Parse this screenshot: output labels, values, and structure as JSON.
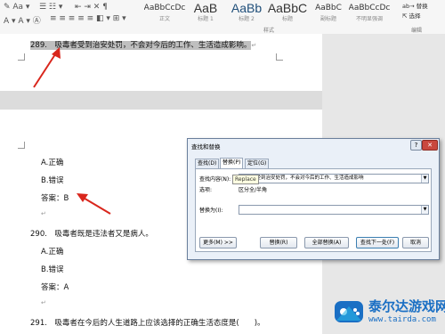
{
  "ribbon": {
    "styles": [
      {
        "preview": "AaBbCcDc",
        "label": "正文"
      },
      {
        "preview": "AaB",
        "label": "标题 1"
      },
      {
        "preview": "AaBb",
        "label": "标题 2"
      },
      {
        "preview": "AaBbC",
        "label": "标题"
      },
      {
        "preview": "AaBbC",
        "label": "副标题"
      },
      {
        "preview": "AaBbCcDc",
        "label": "不明显强调"
      }
    ],
    "styles_group_label": "样式",
    "editing": {
      "replace": "替换",
      "select": "选择",
      "group_label": "编辑"
    }
  },
  "document": {
    "q289": "289.　吸毒者受到治安处罚，不会对今后的工作、生活造成影响。",
    "opt_a": "A.正确",
    "opt_b": "B.错误",
    "ans_label": "答案：",
    "ans_value": "B",
    "q290": "290.　吸毒者既是违法者又是病人。",
    "opt_a2": "A.正确",
    "opt_b2": "B.错误",
    "ans2": "答案：A",
    "q291": "291.　吸毒者在今后的人生道路上应该选择的正确生活态度是(　　)。"
  },
  "dialog": {
    "title": "查找和替换",
    "help": "?",
    "close": "✕",
    "tabs": [
      "查找(D)",
      "替换(P)",
      "定位(G)"
    ],
    "active_tab": 1,
    "find_label": "查找内容(N):",
    "find_value": "吸毒者受到治安处罚，不会对今后的工作、生活造成影响",
    "options_label": "选项:",
    "options_value": "区分全/半角",
    "replace_label": "替换为(I):",
    "replace_value": "",
    "tooltip": "Replace",
    "buttons": {
      "more": "更多(M) >>",
      "replace": "替换(R)",
      "replace_all": "全部替换(A)",
      "find_next": "查找下一处(F)",
      "cancel": "取消"
    }
  },
  "watermark": {
    "title": "泰尔达游戏网",
    "url": "www.tairda.com"
  }
}
